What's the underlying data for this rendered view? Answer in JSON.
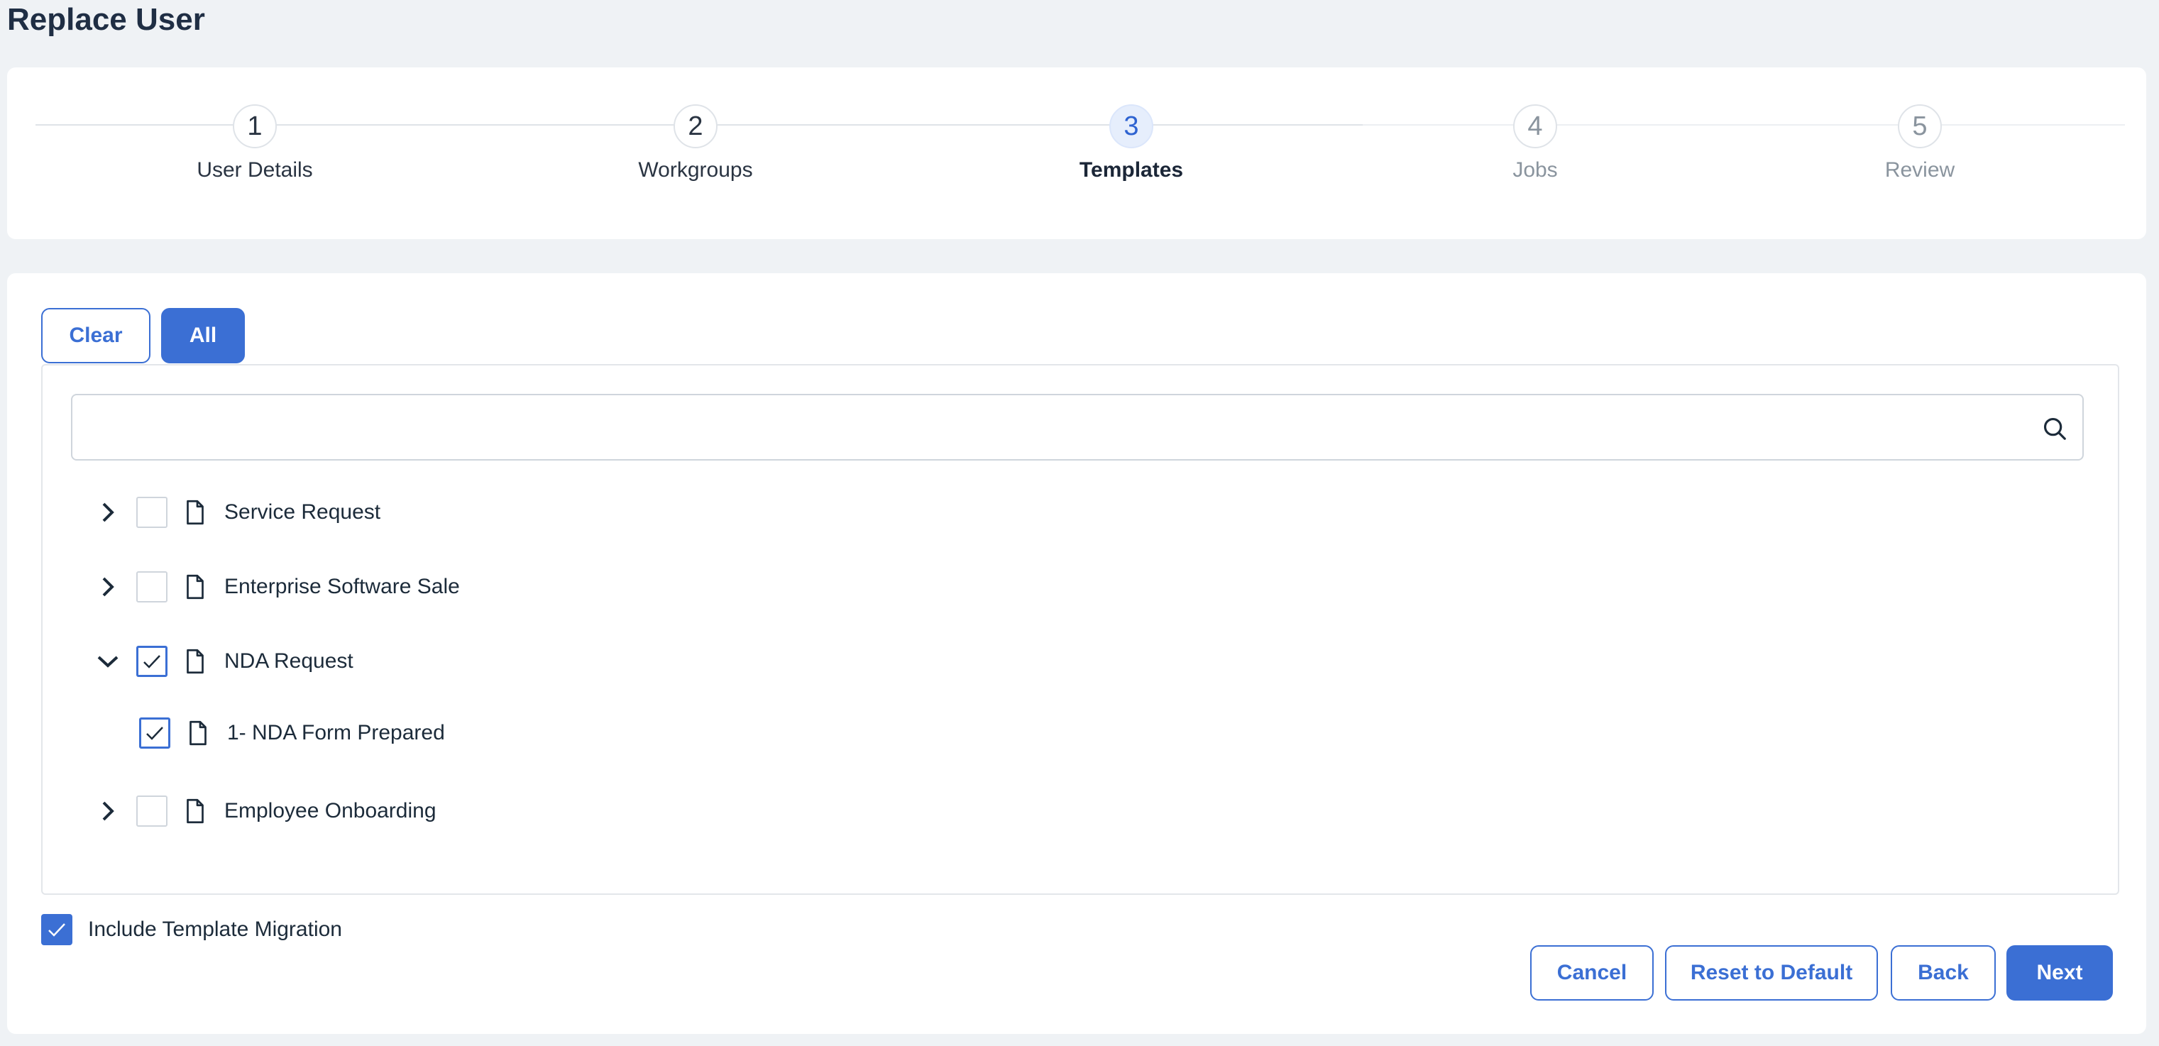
{
  "page": {
    "title": "Replace User"
  },
  "stepper": {
    "steps": [
      {
        "number": "1",
        "label": "User Details",
        "state": "complete"
      },
      {
        "number": "2",
        "label": "Workgroups",
        "state": "complete"
      },
      {
        "number": "3",
        "label": "Templates",
        "state": "active"
      },
      {
        "number": "4",
        "label": "Jobs",
        "state": "future"
      },
      {
        "number": "5",
        "label": "Review",
        "state": "future"
      }
    ]
  },
  "selection": {
    "clear_label": "Clear",
    "all_label": "All"
  },
  "search": {
    "value": "",
    "placeholder": "",
    "icon": "search-icon"
  },
  "tree": {
    "items": [
      {
        "label": "Service Request",
        "expanded": false,
        "checked": false,
        "icon": "document-icon"
      },
      {
        "label": "Enterprise Software Sale",
        "expanded": false,
        "checked": false,
        "icon": "document-icon"
      },
      {
        "label": "NDA Request",
        "expanded": true,
        "checked": true,
        "icon": "document-icon",
        "children": [
          {
            "label": "1- NDA Form Prepared",
            "checked": true,
            "icon": "document-icon"
          }
        ]
      },
      {
        "label": "Employee Onboarding",
        "expanded": false,
        "checked": false,
        "icon": "document-icon"
      }
    ]
  },
  "include_template_migration": {
    "label": "Include Template Migration",
    "checked": true
  },
  "footer": {
    "cancel_label": "Cancel",
    "reset_label": "Reset to Default",
    "back_label": "Back",
    "next_label": "Next"
  },
  "colors": {
    "accent": "#3b6fd4",
    "background": "#eff2f5",
    "card": "#ffffff",
    "active_step_bg": "#e6eefc"
  }
}
